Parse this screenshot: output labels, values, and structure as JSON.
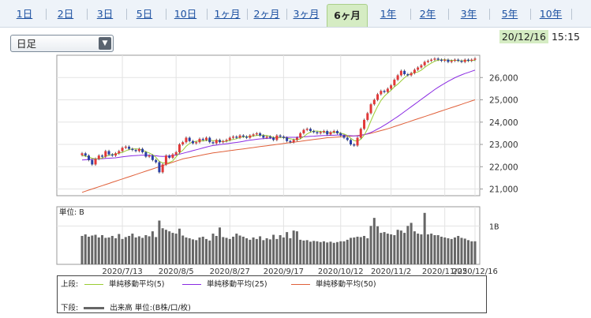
{
  "tabs": [
    {
      "label": "1日"
    },
    {
      "label": "2日"
    },
    {
      "label": "3日"
    },
    {
      "label": "5日"
    },
    {
      "label": "10日"
    },
    {
      "label": "1ヶ月"
    },
    {
      "label": "2ヶ月"
    },
    {
      "label": "3ヶ月"
    },
    {
      "label": "6ヶ月"
    },
    {
      "label": "1年"
    },
    {
      "label": "2年"
    },
    {
      "label": "3年"
    },
    {
      "label": "5年"
    },
    {
      "label": "10年"
    }
  ],
  "active_tab": "6ヶ月",
  "period_select": {
    "value": "日足",
    "arrow": "▼"
  },
  "timestamp": {
    "date": "20/12/16",
    "time": "15:15"
  },
  "legend": {
    "upper_label": "上段:",
    "lower_label": "下段:",
    "ma5": "単純移動平均(5)",
    "ma25": "単純移動平均(25)",
    "ma50": "単純移動平均(50)",
    "volume": "出来高 単位:(B株/口/枚)"
  },
  "colors": {
    "ma5": "#9acd32",
    "ma25": "#8a2be2",
    "ma50": "#e0603a",
    "up": "#e23838",
    "down": "#2a3fa6",
    "volume": "#666666"
  },
  "chart_data": {
    "type": "candlestick",
    "price_axis": {
      "ticks": [
        21000,
        22000,
        23000,
        24000,
        25000,
        26000
      ],
      "tick_labels": [
        "21,000",
        "22,000",
        "23,000",
        "24,000",
        "25,000",
        "26,000"
      ],
      "ylim": [
        20700,
        27000
      ]
    },
    "x_labels": [
      "2020/7/13",
      "2020/8/5",
      "2020/8/27",
      "2020/9/17",
      "2020/10/12",
      "2020/11/2",
      "2020/11/25",
      "2020/12/16"
    ],
    "closes": [
      22600,
      22500,
      22300,
      22100,
      22350,
      22500,
      22450,
      22700,
      22550,
      22500,
      22600,
      22700,
      22850,
      22900,
      22800,
      22750,
      22700,
      22800,
      22650,
      22450,
      22500,
      22300,
      22200,
      21750,
      22100,
      22500,
      22400,
      22550,
      22650,
      23000,
      23100,
      23300,
      23150,
      23050,
      23100,
      23250,
      23200,
      23300,
      23100,
      23050,
      23200,
      23100,
      23150,
      23200,
      23300,
      23350,
      23300,
      23400,
      23350,
      23300,
      23400,
      23450,
      23500,
      23400,
      23300,
      23350,
      23300,
      23200,
      23400,
      23350,
      23300,
      23150,
      23100,
      23200,
      23300,
      23500,
      23650,
      23700,
      23600,
      23550,
      23500,
      23550,
      23600,
      23450,
      23550,
      23600,
      23500,
      23400,
      23300,
      23200,
      23000,
      22950,
      23300,
      23700,
      24100,
      24400,
      24800,
      25000,
      25250,
      25400,
      25350,
      25500,
      25650,
      25900,
      26100,
      26300,
      26150,
      26100,
      26200,
      26350,
      26450,
      26550,
      26700,
      26750,
      26800,
      26850,
      26800,
      26750,
      26800,
      26700,
      26750,
      26800,
      26750,
      26700,
      26800,
      26750,
      26800,
      26850
    ],
    "ma5": [
      22500,
      22480,
      22430,
      22380,
      22350,
      22360,
      22380,
      22470,
      22510,
      22540,
      22570,
      22610,
      22640,
      22710,
      22770,
      22800,
      22800,
      22790,
      22740,
      22670,
      22620,
      22540,
      22420,
      22240,
      22170,
      22170,
      22190,
      22260,
      22440,
      22620,
      22740,
      22920,
      23040,
      23120,
      23140,
      23170,
      23150,
      23180,
      23190,
      23170,
      23170,
      23150,
      23120,
      23140,
      23190,
      23220,
      23260,
      23310,
      23340,
      23340,
      23350,
      23380,
      23400,
      23410,
      23410,
      23400,
      23370,
      23310,
      23310,
      23310,
      23310,
      23280,
      23260,
      23220,
      23210,
      23250,
      23350,
      23470,
      23550,
      23600,
      23600,
      23580,
      23560,
      23530,
      23530,
      23540,
      23540,
      23500,
      23470,
      23400,
      23280,
      23170,
      23150,
      23230,
      23410,
      23690,
      24060,
      24400,
      24710,
      24970,
      25160,
      25300,
      25430,
      25580,
      25700,
      25850,
      25990,
      26110,
      26170,
      26220,
      26250,
      26330,
      26450,
      26560,
      26650,
      26730,
      26780,
      26790,
      26800,
      26780,
      26770,
      26770,
      26760,
      26740,
      26760,
      26760,
      26760,
      26780
    ],
    "ma25": [
      22300,
      22310,
      22320,
      22330,
      22340,
      22350,
      22360,
      22370,
      22380,
      22390,
      22400,
      22420,
      22440,
      22460,
      22480,
      22490,
      22500,
      22510,
      22520,
      22520,
      22510,
      22500,
      22490,
      22470,
      22460,
      22470,
      22480,
      22500,
      22530,
      22560,
      22600,
      22640,
      22680,
      22720,
      22760,
      22800,
      22840,
      22880,
      22920,
      22950,
      22970,
      22990,
      23010,
      23030,
      23050,
      23070,
      23090,
      23110,
      23140,
      23170,
      23190,
      23210,
      23230,
      23250,
      23260,
      23270,
      23280,
      23290,
      23300,
      23310,
      23320,
      23320,
      23320,
      23320,
      23320,
      23330,
      23340,
      23350,
      23360,
      23370,
      23380,
      23390,
      23400,
      23400,
      23410,
      23410,
      23420,
      23420,
      23410,
      23400,
      23390,
      23380,
      23380,
      23400,
      23440,
      23480,
      23540,
      23610,
      23690,
      23770,
      23860,
      23950,
      24050,
      24150,
      24250,
      24360,
      24470,
      24580,
      24690,
      24800,
      24910,
      25020,
      25130,
      25240,
      25350,
      25460,
      25560,
      25650,
      25740,
      25830,
      25910,
      25990,
      26060,
      26120,
      26180,
      26230,
      26280,
      26330
    ],
    "ma50": [
      20850,
      20900,
      20950,
      21000,
      21050,
      21100,
      21150,
      21200,
      21250,
      21300,
      21350,
      21400,
      21450,
      21500,
      21550,
      21600,
      21650,
      21700,
      21750,
      21800,
      21850,
      21900,
      21950,
      22000,
      22050,
      22100,
      22150,
      22200,
      22250,
      22300,
      22350,
      22380,
      22410,
      22440,
      22470,
      22500,
      22530,
      22560,
      22590,
      22620,
      22640,
      22660,
      22680,
      22700,
      22720,
      22740,
      22760,
      22780,
      22800,
      22820,
      22840,
      22860,
      22880,
      22900,
      22920,
      22940,
      22960,
      22980,
      23000,
      23020,
      23040,
      23060,
      23080,
      23100,
      23120,
      23140,
      23160,
      23180,
      23200,
      23220,
      23240,
      23260,
      23280,
      23300,
      23310,
      23320,
      23330,
      23340,
      23350,
      23360,
      23370,
      23380,
      23400,
      23420,
      23440,
      23470,
      23500,
      23540,
      23580,
      23620,
      23660,
      23700,
      23750,
      23800,
      23850,
      23900,
      23950,
      24000,
      24050,
      24100,
      24150,
      24200,
      24250,
      24300,
      24350,
      24400,
      24450,
      24500,
      24550,
      24600,
      24650,
      24700,
      24750,
      24800,
      24850,
      24900,
      24950,
      25000
    ],
    "volume_axis": {
      "unit_label": "単位: B",
      "tick_label": "1B",
      "tick_value": 1.0,
      "ylim": [
        0,
        1.5
      ]
    },
    "volumes": [
      0.74,
      0.78,
      0.72,
      0.75,
      0.77,
      0.7,
      0.76,
      0.69,
      0.7,
      0.74,
      0.68,
      0.79,
      0.66,
      0.71,
      0.74,
      0.8,
      0.7,
      0.73,
      0.69,
      0.76,
      0.73,
      0.86,
      0.71,
      1.14,
      0.94,
      0.9,
      0.86,
      0.82,
      0.8,
      0.93,
      0.75,
      0.7,
      0.68,
      0.65,
      0.63,
      0.7,
      0.72,
      0.66,
      0.62,
      0.8,
      0.74,
      0.96,
      0.71,
      0.69,
      0.66,
      0.72,
      0.8,
      0.75,
      0.72,
      0.68,
      0.64,
      0.7,
      0.66,
      0.73,
      0.63,
      0.68,
      0.65,
      0.77,
      0.66,
      0.76,
      0.7,
      0.84,
      0.68,
      0.88,
      0.86,
      0.64,
      0.62,
      0.63,
      0.59,
      0.61,
      0.6,
      0.58,
      0.6,
      0.57,
      0.59,
      0.56,
      0.58,
      0.6,
      0.6,
      0.64,
      0.69,
      0.7,
      0.72,
      0.71,
      0.74,
      0.68,
      1.0,
      1.21,
      0.99,
      0.82,
      0.84,
      0.8,
      0.78,
      0.76,
      0.9,
      0.88,
      0.82,
      1.0,
      1.08,
      0.86,
      0.8,
      0.78,
      1.34,
      0.78,
      0.8,
      0.76,
      0.76,
      0.72,
      0.7,
      0.68,
      0.66,
      0.7,
      0.74,
      0.69,
      0.67,
      0.63,
      0.6,
      0.6
    ]
  }
}
